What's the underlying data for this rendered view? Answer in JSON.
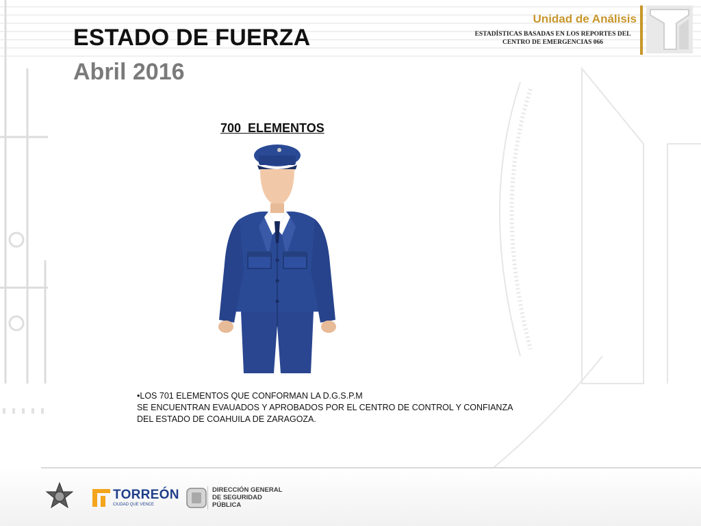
{
  "header": {
    "title": "ESTADO DE FUERZA",
    "subtitle": "Abril 2016"
  },
  "unit": {
    "name": "Unidad de Análisis",
    "description_line1": "ESTADÍSTICAS BASADAS EN LOS REPORTES DEL",
    "description_line2": "CENTRO DE EMERGENCIAS 066",
    "accent_color": "#c8962a"
  },
  "main": {
    "count_heading": "700  ELEMENTOS",
    "figure_icon": "police-officer-uniform-icon",
    "note_line1": "•LOS 701 ELEMENTOS QUE CONFORMAN LA D.G.S.P.M",
    "note_line2": "SE ENCUENTRAN EVAUADOS Y APROBADOS POR EL CENTRO DE CONTROL Y CONFIANZA",
    "note_line3": "DEL ESTADO DE COAHUILA DE ZARAGOZA."
  },
  "footer": {
    "badge_icon": "police-star-badge-icon",
    "torreon_name": "TORREÓN",
    "torreon_tagline": "CIUDAD QUE VENCE",
    "dgsp_line1": "DIRECCIÓN GENERAL",
    "dgsp_line2": "DE SEGURIDAD",
    "dgsp_line3": "PÚBLICA",
    "uniform_color": "#2b4a96"
  }
}
